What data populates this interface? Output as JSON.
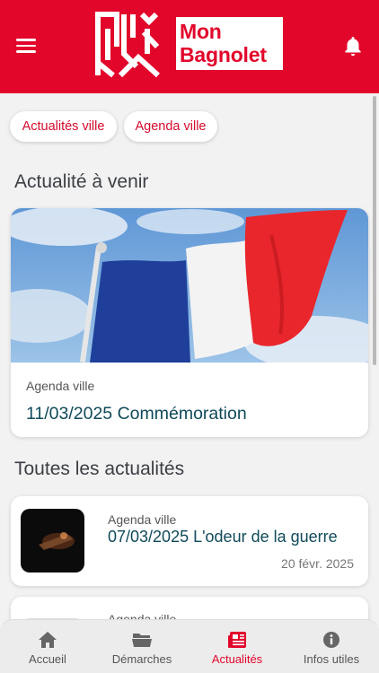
{
  "header": {
    "logo_line1": "Mon",
    "logo_line2": "Bagnolet",
    "menu_icon": "hamburger-menu-icon",
    "notification_icon": "bell-icon"
  },
  "filters": [
    {
      "label": "Actualités ville"
    },
    {
      "label": "Agenda ville"
    }
  ],
  "upcoming": {
    "section_title": "Actualité à venir",
    "card": {
      "category": "Agenda ville",
      "title": "11/03/2025 Commémoration",
      "image": "french-flag-photo"
    }
  },
  "all_news": {
    "section_title": "Toutes les actualités",
    "items": [
      {
        "category": "Agenda ville",
        "title": "07/03/2025 L'odeur de la guerre",
        "date": "20 févr. 2025",
        "image": "dark-theatre-photo"
      },
      {
        "category": "Agenda ville",
        "title": "",
        "date": ""
      }
    ]
  },
  "tabs": [
    {
      "label": "Accueil",
      "icon": "home-icon"
    },
    {
      "label": "Démarches",
      "icon": "folder-icon"
    },
    {
      "label": "Actualités",
      "icon": "newspaper-icon",
      "active": true
    },
    {
      "label": "Infos utiles",
      "icon": "info-icon"
    }
  ],
  "colors": {
    "brand_red": "#e2062b",
    "title_teal": "#0f4a5a",
    "background": "#f2f2f2"
  }
}
